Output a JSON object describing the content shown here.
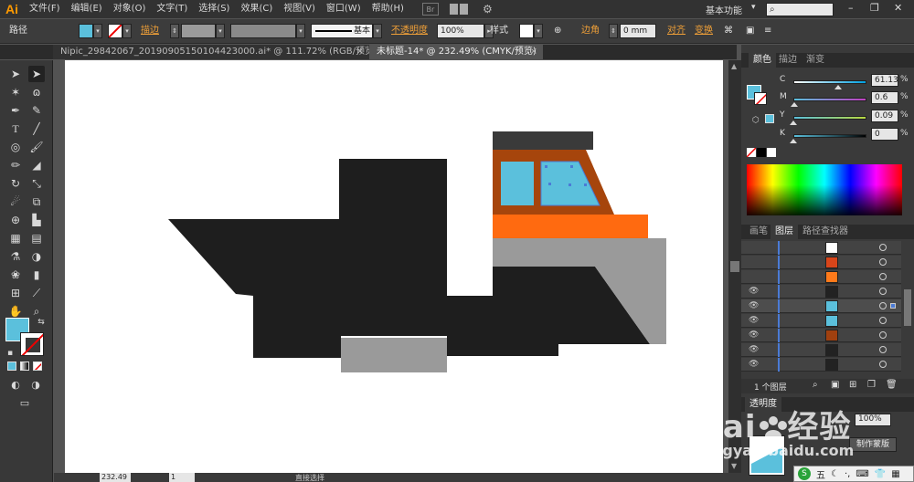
{
  "app": {
    "logo": "Ai"
  },
  "menu": [
    "文件(F)",
    "编辑(E)",
    "对象(O)",
    "文字(T)",
    "选择(S)",
    "效果(C)",
    "视图(V)",
    "窗口(W)",
    "帮助(H)"
  ],
  "menu_extra": {
    "bridge": "Br",
    "workspace": "基本功能",
    "ws_arrow": "▾",
    "search_icon": "⌕",
    "minimize": "–",
    "restore": "❐",
    "close": "✕"
  },
  "control": {
    "selection_label": "路径",
    "fill_color": "#5bc0dc",
    "stroke_label": "描边",
    "stroke_weight": "",
    "brush_label": "基本",
    "opacity_label": "不透明度",
    "opacity_value": "100%",
    "style_label": "样式",
    "corner_label": "边角",
    "corner_value": "0 mm",
    "align_label": "对齐",
    "transform_label": "变换"
  },
  "tabs": [
    {
      "label": "Nipic_29842067_20190905150104423000.ai* @ 111.72% (RGB/预览)",
      "close": "×",
      "active": false
    },
    {
      "label": "未标题-14* @ 232.49% (CMYK/预览)",
      "close": "×",
      "active": true
    }
  ],
  "tools": [
    "selection-tool",
    "direct-selection-tool",
    "magic-wand-tool",
    "lasso-tool",
    "pen-tool",
    "curvature-tool",
    "type-tool",
    "line-tool",
    "ellipse-tool",
    "paintbrush-tool",
    "pencil-tool",
    "eraser-tool",
    "rotate-tool",
    "scale-tool",
    "warp-tool",
    "free-transform-tool",
    "shape-builder-tool",
    "live-paint-tool",
    "perspective-tool",
    "mesh-tool",
    "gradient-tool",
    "eyedropper-tool",
    "blend-tool",
    "symbol-sprayer-tool",
    "graph-tool",
    "column-graph-tool",
    "artboard-tool",
    "slice-tool",
    "hand-tool",
    "zoom-tool"
  ],
  "colors_panel": {
    "tabs": [
      "颜色",
      "描边",
      "渐变"
    ],
    "channels": [
      {
        "label": "C",
        "value": "61.13",
        "fraction": 0.61,
        "track": "linear-gradient(90deg,#fff,#00a0e0)"
      },
      {
        "label": "M",
        "value": "0.6",
        "fraction": 0.01,
        "track": "linear-gradient(90deg,#5bc0dc,#c040c0)"
      },
      {
        "label": "Y",
        "value": "0.09",
        "fraction": 0.0,
        "track": "linear-gradient(90deg,#5bc0dc,#b8d840)"
      },
      {
        "label": "K",
        "value": "0",
        "fraction": 0.0,
        "track": "linear-gradient(90deg,#5bc0dc,#000)"
      }
    ],
    "pct": "%"
  },
  "layers_panel": {
    "tabs": [
      "画笔",
      "图层",
      "路径查找器"
    ],
    "footer_label": "1 个图层",
    "rows": [
      {
        "eye": "",
        "thumb_color": "#ffffff"
      },
      {
        "eye": "",
        "thumb_color": "#d8451a"
      },
      {
        "eye": "",
        "thumb_color": "#ff7a1a"
      },
      {
        "eye": "👁",
        "thumb_color": "#222222"
      },
      {
        "eye": "👁",
        "thumb_color": "#5bc0dc",
        "selected": true
      },
      {
        "eye": "👁",
        "thumb_color": "#5bc0dc"
      },
      {
        "eye": "👁",
        "thumb_color": "#a0400f"
      },
      {
        "eye": "👁",
        "thumb_color": "#222222"
      },
      {
        "eye": "👁",
        "thumb_color": "#222222"
      }
    ]
  },
  "lower_panel": {
    "label": "透明度",
    "pct_value": "100%",
    "mask_button": "制作蒙版"
  },
  "status": {
    "zoom": "232.49",
    "page": "1",
    "tool": "直接选择"
  },
  "watermark": {
    "brand": "Bai",
    "brand_cn": "经验",
    "url": "jingyan.baidu.com"
  },
  "ime": {
    "label": "五"
  }
}
